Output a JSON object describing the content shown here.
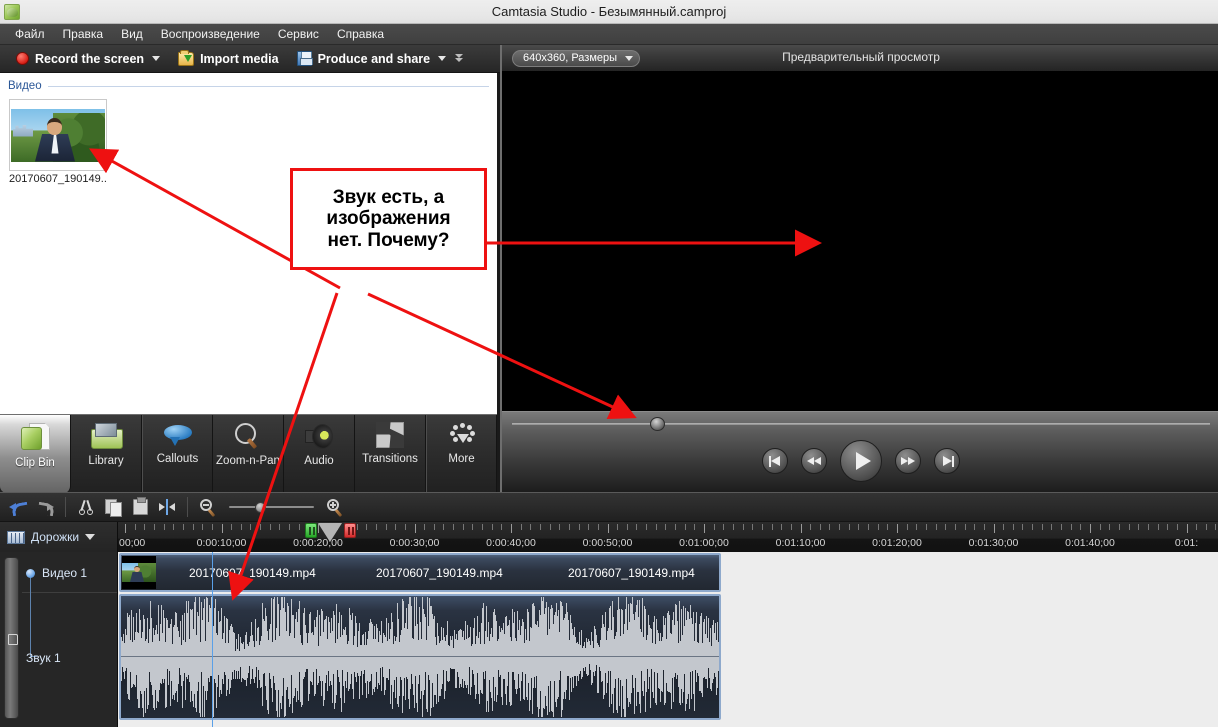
{
  "window": {
    "title": "Camtasia Studio - Безымянный.camproj",
    "app_icon": "camtasia-leaf-icon"
  },
  "menu": {
    "items": [
      {
        "label": "Файл"
      },
      {
        "label": "Правка"
      },
      {
        "label": "Вид"
      },
      {
        "label": "Воспроизведение"
      },
      {
        "label": "Сервис"
      },
      {
        "label": "Справка"
      }
    ]
  },
  "toolbar": {
    "record_label": "Record the screen",
    "import_label": "Import media",
    "produce_label": "Produce and share"
  },
  "clip_bin": {
    "group_label": "Видео",
    "items": [
      {
        "caption": "20170607_190149...."
      }
    ]
  },
  "tabs": [
    {
      "label": "Clip Bin",
      "icon": "clip-bin-icon",
      "active": true
    },
    {
      "label": "Library",
      "icon": "library-folder-icon",
      "active": false
    },
    {
      "label": "Callouts",
      "icon": "speech-bubble-icon",
      "active": false
    },
    {
      "label": "Zoom-n-Pan",
      "icon": "magnifier-icon",
      "active": false
    },
    {
      "label": "Audio",
      "icon": "speaker-icon",
      "active": false
    },
    {
      "label": "Transitions",
      "icon": "transitions-icon",
      "active": false
    },
    {
      "label": "More",
      "icon": "more-dots-icon",
      "active": false
    }
  ],
  "preview": {
    "size_option": "640x360, Размеры",
    "title": "Предварительный просмотр",
    "controls": [
      {
        "name": "go-to-start",
        "glyph": "skip-back-icon"
      },
      {
        "name": "rewind",
        "glyph": "rewind-icon"
      },
      {
        "name": "play",
        "glyph": "play-icon"
      },
      {
        "name": "fast-forward",
        "glyph": "fast-forward-icon"
      },
      {
        "name": "go-to-end",
        "glyph": "skip-forward-icon"
      }
    ],
    "scrub_percent": 20
  },
  "timeline_toolbar": {
    "buttons": [
      {
        "name": "undo",
        "icon": "undo-arrow-icon"
      },
      {
        "name": "redo",
        "icon": "redo-arrow-icon"
      },
      {
        "name": "cut",
        "icon": "scissors-icon"
      },
      {
        "name": "copy",
        "icon": "copy-icon"
      },
      {
        "name": "paste",
        "icon": "paste-icon"
      },
      {
        "name": "split",
        "icon": "split-icon"
      },
      {
        "name": "zoom-out",
        "icon": "zoom-out-icon"
      },
      {
        "name": "zoom-in",
        "icon": "zoom-in-icon"
      }
    ],
    "zoom_slider_percent": 32
  },
  "timeline": {
    "tracks_label": "Дорожки",
    "ruler_labels": [
      "00;00",
      "0:00:10;00",
      "0:00:20;00",
      "0:00:30;00",
      "0:00:40;00",
      "0:00:50;00",
      "0:01:00;00",
      "0:01:10;00",
      "0:01:20;00",
      "0:01:30;00",
      "0:01:40;00",
      "0:01:"
    ],
    "playhead_position_label": "0:00:10;00",
    "tracks": [
      {
        "name": "Видео 1"
      },
      {
        "name": "Звук 1"
      }
    ],
    "video_clip_labels": [
      "20170607_190149.mp4",
      "20170607_190149.mp4",
      "20170607_190149.mp4"
    ]
  },
  "annotation": {
    "text_line1": "Звук есть, а",
    "text_line2": "изображения",
    "text_line3": "нет. Почему?",
    "border_color": "#ee1111",
    "arrow_color": "#ee1111"
  },
  "colors": {
    "accent_red": "#ee1111",
    "titlebar_bg": "#e8e8e8",
    "menubar_bg": "#454545",
    "panel_dark": "#2a2a2a",
    "clip_border": "#8ea9cc",
    "playhead_blue": "#5aa0e8"
  }
}
